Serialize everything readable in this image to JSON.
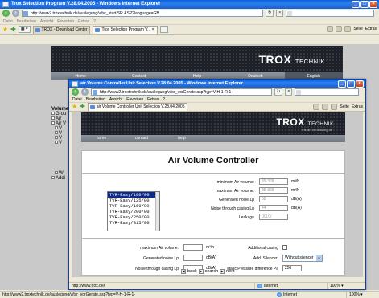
{
  "outer": {
    "title": "Trox Selection Program V.28.04.2005 - Windows Internet Explorer",
    "address": "http://www2.troxtechnik.de/auslegung/v/tvr_start/SR.ASP?language=GB",
    "menu": [
      "Datei",
      "Bearbeiten",
      "Ansicht",
      "Favoriten",
      "Extras",
      "?"
    ],
    "tabs": [
      {
        "label": "TROX - Download Center"
      },
      {
        "label": "Trox Selection Program V..."
      }
    ],
    "tools": {
      "page": "Seite",
      "extras": "Extras"
    },
    "logo": "TROX",
    "logo_suffix": "TECHNIK",
    "nav": [
      "Home",
      "Contact",
      "Help",
      "Deutsch",
      "English"
    ],
    "nav_selected": 4,
    "tree": [
      {
        "text": "Volume",
        "bold": true
      },
      {
        "text": "Grou",
        "bold": false
      },
      {
        "text": "Air",
        "bold": false
      },
      {
        "text": "Air V",
        "bold": false
      },
      {
        "text": "V",
        "bold": false
      },
      {
        "text": "V",
        "bold": false
      },
      {
        "text": "V",
        "bold": false
      },
      {
        "text": "V",
        "bold": false
      }
    ],
    "tree_bottom": [
      {
        "text": "W",
        "bold": false
      },
      {
        "text": "Addi",
        "bold": false
      }
    ],
    "status_url": "http://www2.troxtechnik.de/auslegung/v/tvr_vorGerate.asp?typ=V-H-1-R-1-",
    "status_zone": "Internet",
    "status_zoom": "100%"
  },
  "popup": {
    "title": "air Volume Controller Unit Selection V.28.04.2005 - Windows Internet Explorer",
    "address": "http://www2.troxtechnik.de/auslegung/v/tvr_vorGerate.asp?typ=V-H-1-R-1-",
    "menu": [
      "Datei",
      "Bearbeiten",
      "Ansicht",
      "Favoriten",
      "Extras",
      "?"
    ],
    "tab": "air Volume Controller Unit Selection V.28.04.2005",
    "tools": {
      "page": "Seite",
      "extras": "Extras"
    },
    "logo": "TROX",
    "logo_suffix": "TECHNIK",
    "tagline": "The art of handling air",
    "nav": [
      "home",
      "contact",
      "help"
    ],
    "status_url": "http://www.trox.de/",
    "status_zone": "Internet",
    "status_zoom": "100%"
  },
  "form": {
    "heading": "Air Volume Controller",
    "models": [
      "TVR-Easy/100/00",
      "TVR-Easy/125/00",
      "TVR-Easy/160/00",
      "TVR-Easy/200/00",
      "TVR-Easy/250/00",
      "TVR-Easy/315/00"
    ],
    "selected_model_index": 0,
    "right_fields": [
      {
        "label": "minimum Air volume:",
        "value": "39-368",
        "unit": "m³/h"
      },
      {
        "label": "maximum Air volume:",
        "value": "39-368",
        "unit": "m³/h"
      },
      {
        "label": "Generated noise Lp",
        "value": "58",
        "unit": "dB(A)"
      },
      {
        "label": "Noise through casing Lp",
        "value": "44",
        "unit": "dB(A)"
      },
      {
        "label": "Leakage",
        "value": "0/3.0/",
        "unit": ""
      }
    ],
    "left_inputs": [
      {
        "label": "maximum Air volume:",
        "value": "",
        "unit": "m³/h"
      },
      {
        "label": "Generated noise Lp",
        "value": "",
        "unit": "dB(A)"
      },
      {
        "label": "Noise through casing Lp",
        "value": "",
        "unit": "dB(A)"
      }
    ],
    "additional_casing_label": "Additional casing",
    "silencer_label": "Add. Silencer:",
    "silencer_value": "Without silencer",
    "pressure_label": "static Pressure difference Pa",
    "pressure_value": "250",
    "back_label": "back",
    "search_label": "search",
    "next_label": "next"
  }
}
